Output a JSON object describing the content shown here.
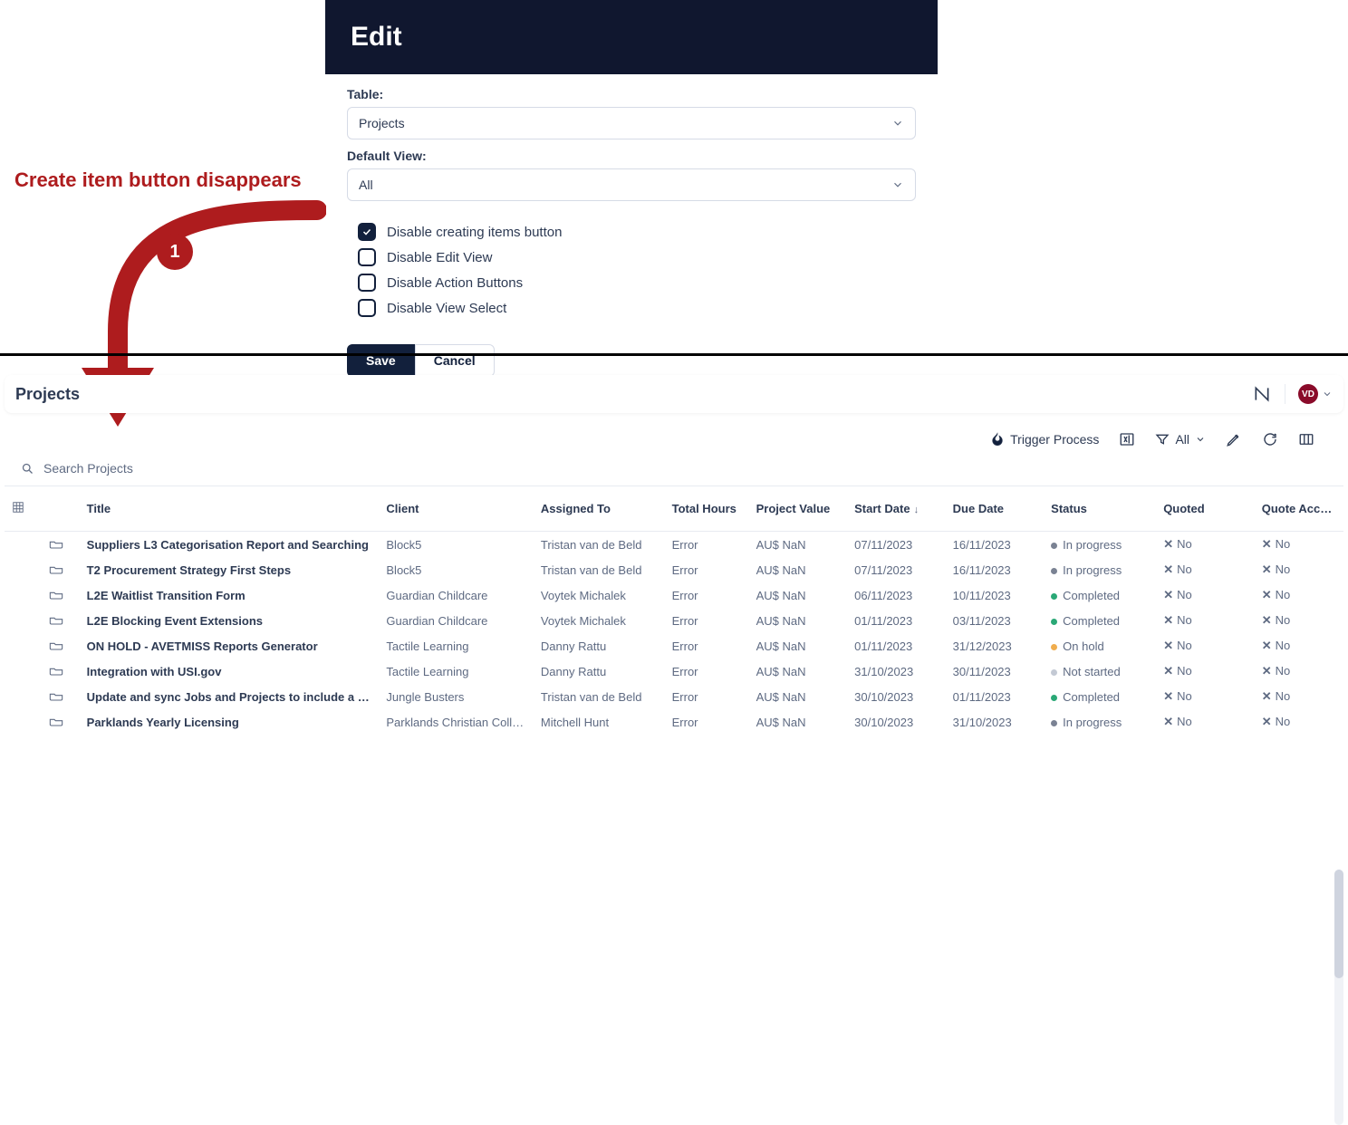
{
  "annotation": {
    "text": "Create item button disappears",
    "badge": "1"
  },
  "edit_panel": {
    "title": "Edit",
    "labels": {
      "table": "Table:",
      "default_view": "Default View:"
    },
    "table_select": "Projects",
    "default_view_select": "All",
    "checkboxes": {
      "disable_create": {
        "label": "Disable creating items button",
        "checked": true
      },
      "disable_edit_view": {
        "label": "Disable Edit View",
        "checked": false
      },
      "disable_action_buttons": {
        "label": "Disable Action Buttons",
        "checked": false
      },
      "disable_view_select": {
        "label": "Disable View Select",
        "checked": false
      }
    },
    "buttons": {
      "save": "Save",
      "cancel": "Cancel"
    }
  },
  "projects": {
    "title": "Projects",
    "avatar_initials": "VD",
    "toolbar": {
      "trigger_process": "Trigger Process",
      "filter_label": "All"
    },
    "search_placeholder": "Search Projects",
    "columns": {
      "title": "Title",
      "client": "Client",
      "assigned": "Assigned To",
      "hours": "Total Hours",
      "value": "Project Value",
      "start": "Start Date",
      "due": "Due Date",
      "status": "Status",
      "quoted": "Quoted",
      "qa": "Quote Accept…"
    },
    "rows": [
      {
        "title": "Suppliers L3 Categorisation Report and Searching",
        "client": "Block5",
        "assigned": "Tristan van de Beld",
        "hours": "Error",
        "value": "AU$ NaN",
        "start": "07/11/2023",
        "due": "16/11/2023",
        "status": "In progress",
        "status_color": "gray",
        "quoted": "No",
        "qa": "No"
      },
      {
        "title": "T2 Procurement Strategy First Steps",
        "client": "Block5",
        "assigned": "Tristan van de Beld",
        "hours": "Error",
        "value": "AU$ NaN",
        "start": "07/11/2023",
        "due": "16/11/2023",
        "status": "In progress",
        "status_color": "gray",
        "quoted": "No",
        "qa": "No"
      },
      {
        "title": "L2E Waitlist Transition Form",
        "client": "Guardian Childcare",
        "assigned": "Voytek Michalek",
        "hours": "Error",
        "value": "AU$ NaN",
        "start": "06/11/2023",
        "due": "10/11/2023",
        "status": "Completed",
        "status_color": "green",
        "quoted": "No",
        "qa": "No"
      },
      {
        "title": "L2E Blocking Event Extensions",
        "client": "Guardian Childcare",
        "assigned": "Voytek Michalek",
        "hours": "Error",
        "value": "AU$ NaN",
        "start": "01/11/2023",
        "due": "03/11/2023",
        "status": "Completed",
        "status_color": "green",
        "quoted": "No",
        "qa": "No"
      },
      {
        "title": "ON HOLD - AVETMISS Reports Generator",
        "client": "Tactile Learning",
        "assigned": "Danny Rattu",
        "hours": "Error",
        "value": "AU$ NaN",
        "start": "01/11/2023",
        "due": "31/12/2023",
        "status": "On hold",
        "status_color": "amber",
        "quoted": "No",
        "qa": "No"
      },
      {
        "title": "Integration with USI.gov",
        "client": "Tactile Learning",
        "assigned": "Danny Rattu",
        "hours": "Error",
        "value": "AU$ NaN",
        "start": "31/10/2023",
        "due": "30/11/2023",
        "status": "Not started",
        "status_color": "lgray",
        "quoted": "No",
        "qa": "No"
      },
      {
        "title": "Update and sync Jobs and Projects to include a sin…",
        "client": "Jungle Busters",
        "assigned": "Tristan van de Beld",
        "hours": "Error",
        "value": "AU$ NaN",
        "start": "30/10/2023",
        "due": "01/11/2023",
        "status": "Completed",
        "status_color": "green",
        "quoted": "No",
        "qa": "No"
      },
      {
        "title": "Parklands Yearly Licensing",
        "client": "Parklands Christian College",
        "assigned": "Mitchell Hunt",
        "hours": "Error",
        "value": "AU$ NaN",
        "start": "30/10/2023",
        "due": "31/10/2023",
        "status": "In progress",
        "status_color": "gray",
        "quoted": "No",
        "qa": "No"
      }
    ]
  }
}
